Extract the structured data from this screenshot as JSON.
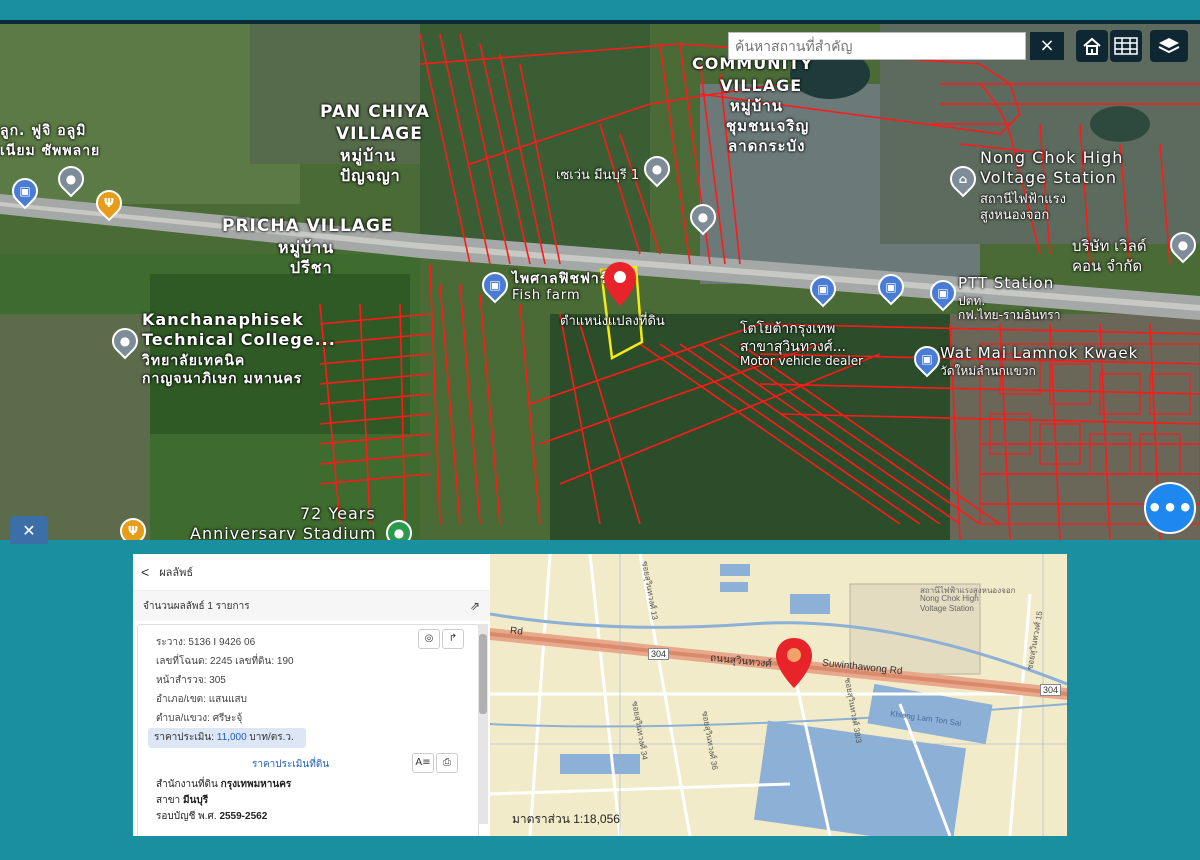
{
  "search": {
    "placeholder": "ค้นหาสถานที่สำคัญ",
    "clear_label": "×"
  },
  "map_buttons": {
    "home_icon": "home-icon",
    "grid_icon": "grid-icon",
    "layers_icon": "layers-icon"
  },
  "more_button": {
    "label": "•••"
  },
  "map_labels": {
    "pan_chiya_en": "PAN CHIYA",
    "pan_chiya_village_en": "VILLAGE",
    "pan_chiya_th1": "หมู่บ้าน",
    "pan_chiya_th2": "ปัญจญา",
    "community": "COMMUNITY",
    "village2": "VILLAGE",
    "village2_th1": "หมู่บ้าน",
    "village2_th2": "ชุมชนเจริญ",
    "village2_th3": "ลาดกระบัง",
    "pricha_en": "PRICHA VILLAGE",
    "pricha_th1": "หมู่บ้าน",
    "pricha_th2": "ปรีชา",
    "kanchana_en1": "Kanchanaphisek",
    "kanchana_en2": "Technical College...",
    "kanchana_th1": "วิทยาลัยเทคนิค",
    "kanchana_th2": "กาญจนาภิเษก มหานคร",
    "fish_farm_th": "ไพศาลฟิชฟาร์ม",
    "fish_farm_en": "Fish farm",
    "location_label": "ตำแหน่งแปลงที่ดิน",
    "seven_eleven": "เซเว่น มีนบุรี 1",
    "nong_chok_1": "Nong Chok High",
    "nong_chok_2": "Voltage Station",
    "nong_chok_th1": "สถานีไฟฟ้าแรง",
    "nong_chok_th2": "สูงหนองจอก",
    "company_th1": "บริษัท เวิลด์",
    "company_th2": "คอน จำกัด",
    "ptt_1": "PTT Station",
    "ptt_2": "ปตท.",
    "ptt_3": "กฟ.ไทย-รามอินทรา",
    "krungthep_1": "โตโยต้ากรุงเทพ",
    "krungthep_2": "สาขาสุวินทวงศ์...",
    "motor_dealer": "Motor vehicle dealer",
    "wat_mai": "Wat Mai Lamnok Kwaek",
    "wat_mai_th": "วัดใหม่ลำนกแขวก",
    "stadium_1": "72 Years",
    "stadium_2": "Anniversary Stadium",
    "left_top_1": "ลูก. ฟูจิ อลูมิ",
    "left_top_2": "เนียม ซัพพลาย"
  },
  "result_panel": {
    "back_label": "<",
    "title": "ผลลัพธ์",
    "count_text": "จำนวนผลลัพธ์ 1 รายการ",
    "fields": [
      "ระวาง: 5136 I 9426 06",
      "เลขที่โฉนด: 2245 เลขที่ดิน: 190",
      "หน้าสำรวจ: 305",
      "อำเภอ/เขต: แสนแสบ",
      "ตำบล/แขวง: ศรีษะจุ้"
    ],
    "price_prefix": "ราคาประเมิน:",
    "price_value": "11,000",
    "price_unit": "บาท/ตร.ว.",
    "assessment_title": "ราคาประเมินที่ดิน",
    "office_prefix": "สำนักงานที่ดิน",
    "office_value": "กรุงเทพมหานคร",
    "branch_prefix": "สาขา",
    "branch_value": "มีนบุรี",
    "period_prefix": "รอบบัญชี พ.ศ.",
    "period_value": "2559-2562"
  },
  "street_map": {
    "road_304": "304",
    "road_name": "ถนนสุวินทวงศ์",
    "road_name_en": "Suwinthawong Rd",
    "road_rd": "Rd",
    "scale_label": "มาตราส่วน 1:18,056",
    "station_label_1": "สถานีไฟฟ้าแรงสูงหนองจอก",
    "station_label_2": "Nong Chok High",
    "station_label_3": "Voltage Station",
    "soi_labels": [
      "ซอยสุวินทวงศ์ 13",
      "ซอยสุวินทวงศ์ 34",
      "ซอยสุวินทวงศ์ 36",
      "ซอยสุวินทวงศ์ 38/3",
      "ซอยสุวินทวงศ์ 15"
    ],
    "canal_label": "Khlong Lam Ton Sai"
  }
}
